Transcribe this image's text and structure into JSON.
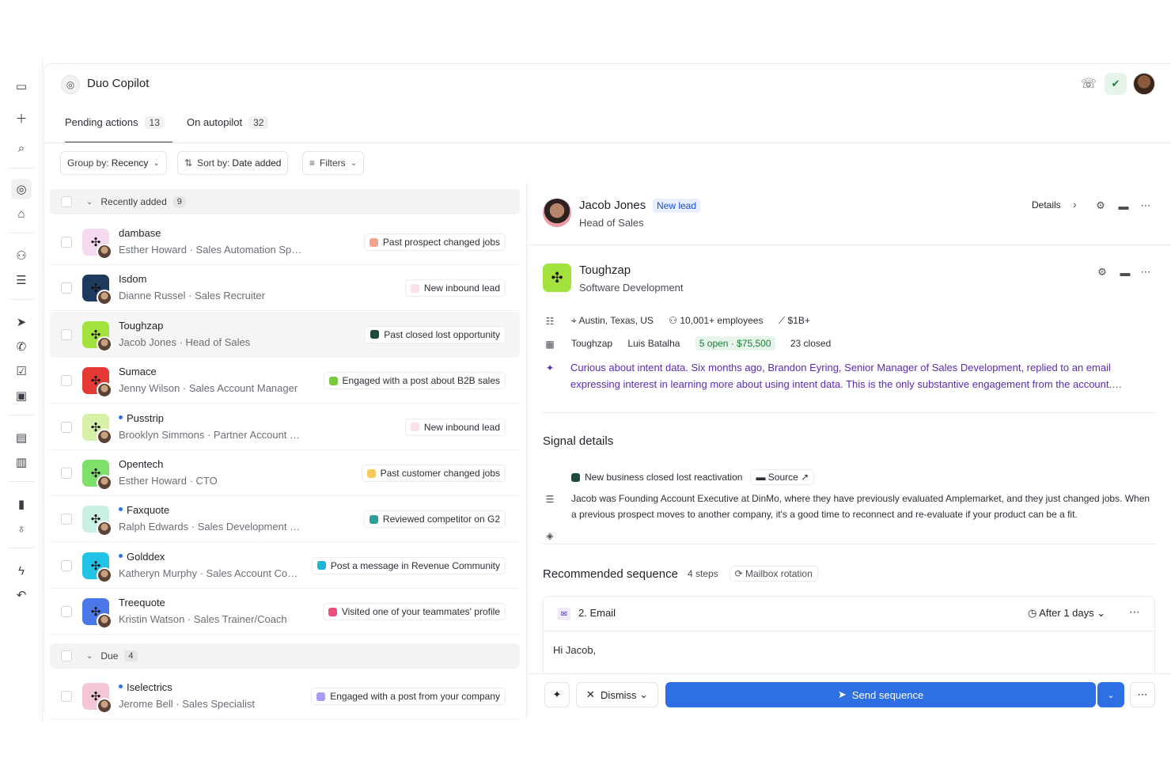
{
  "app": {
    "title": "Duo Copilot"
  },
  "tabs": [
    {
      "label": "Pending actions",
      "count": "13"
    },
    {
      "label": "On autopilot",
      "count": "32"
    }
  ],
  "toolbar": {
    "group_label": "Group by:",
    "group_value": "Recency",
    "sort_label": "Sort by:",
    "sort_value": "Date added",
    "filters_label": "Filters"
  },
  "groups": [
    {
      "label": "Recently added",
      "count": "9"
    },
    {
      "label": "Due",
      "count": "4"
    }
  ],
  "rows": [
    {
      "company": "dambase",
      "person": "Esther Howard · Sales Automation Specialist",
      "signal": "Past prospect changed jobs",
      "signal_color": "#f4a48c",
      "logo_bg": "#f5d9f0",
      "new": false
    },
    {
      "company": "Isdom",
      "person": "Dianne Russel · Sales Recruiter",
      "signal": "New inbound lead",
      "signal_color": "#fbe1e6",
      "logo_bg": "#1e3a5f",
      "new": false
    },
    {
      "company": "Toughzap",
      "person": "Jacob Jones · Head of Sales",
      "signal": "Past closed lost opportunity",
      "signal_color": "#1e4a3a",
      "logo_bg": "#a3e23d",
      "new": false
    },
    {
      "company": "Sumace",
      "person": "Jenny Wilson · Sales Account Manager",
      "signal": "Engaged with a post about B2B sales",
      "signal_color": "#7ac943",
      "logo_bg": "#e53935",
      "new": false
    },
    {
      "company": "Pusstrip",
      "person": "Brooklyn Simmons · Partner Account Manager",
      "signal": "New inbound lead",
      "signal_color": "#fbe1e6",
      "logo_bg": "#d6f0a6",
      "new": true
    },
    {
      "company": "Opentech",
      "person": "Esther Howard · CTO",
      "signal": "Past customer changed jobs",
      "signal_color": "#f7c95c",
      "logo_bg": "#7ee06a",
      "new": false
    },
    {
      "company": "Faxquote",
      "person": "Ralph Edwards · Sales Development Manager",
      "signal": "Reviewed competitor on G2",
      "signal_color": "#2aa198",
      "logo_bg": "#c9f0e4",
      "new": true
    },
    {
      "company": "Golddex",
      "person": "Katheryn Murphy · Sales Account Co…",
      "signal": "Post a message in Revenue Community",
      "signal_color": "#1fb5d4",
      "logo_bg": "#22c3e6",
      "new": true
    },
    {
      "company": "Treequote",
      "person": "Kristin Watson · Sales Trainer/Coach",
      "signal": "Visited one of your teammates' profile",
      "signal_color": "#ec4f7c",
      "logo_bg": "#4a78e8",
      "new": false
    },
    {
      "company": "Iselectrics",
      "person": "Jerome Bell · Sales Specialist",
      "signal": "Engaged with a post from your company",
      "signal_color": "#a79cf0",
      "logo_bg": "#f4c6d4",
      "new": true
    }
  ],
  "detail": {
    "person_name": "Jacob Jones",
    "person_badge": "New lead",
    "person_title": "Head of Sales",
    "details_label": "Details",
    "company_name": "Toughzap",
    "company_industry": "Software Development",
    "location": "Austin, Texas, US",
    "employees": "10,001+ employees",
    "revenue": "$1B+",
    "account": "Toughzap",
    "owner": "Luis Batalha",
    "open_deals": "5 open · $75,500",
    "closed_deals": "23 closed",
    "ai_summary": "Curious about intent data. Six months ago, Brandon Eyring, Senior Manager of Sales Development, replied to an email expressing interest in learning more about using intent data. This is the only substantive engagement from the account.…",
    "signal_title": "Signal details",
    "signal_name": "New business closed lost reactivation",
    "signal_source": "Source",
    "signal_text": "Jacob was Founding Account Executive at DinMo, where they have previously evaluated Amplemarket, and they just changed jobs. When a previous prospect moves to another company, it's a good time to reconnect and re-evaluate if your product can be a fit.",
    "seq_title": "Recommended sequence",
    "seq_steps": "4 steps",
    "seq_mailbox": "Mailbox rotation",
    "step_title": "2. Email",
    "step_delay": "After 1 days",
    "email_body": "Hi Jacob,",
    "dismiss_label": "Dismiss",
    "send_label": "Send sequence"
  }
}
